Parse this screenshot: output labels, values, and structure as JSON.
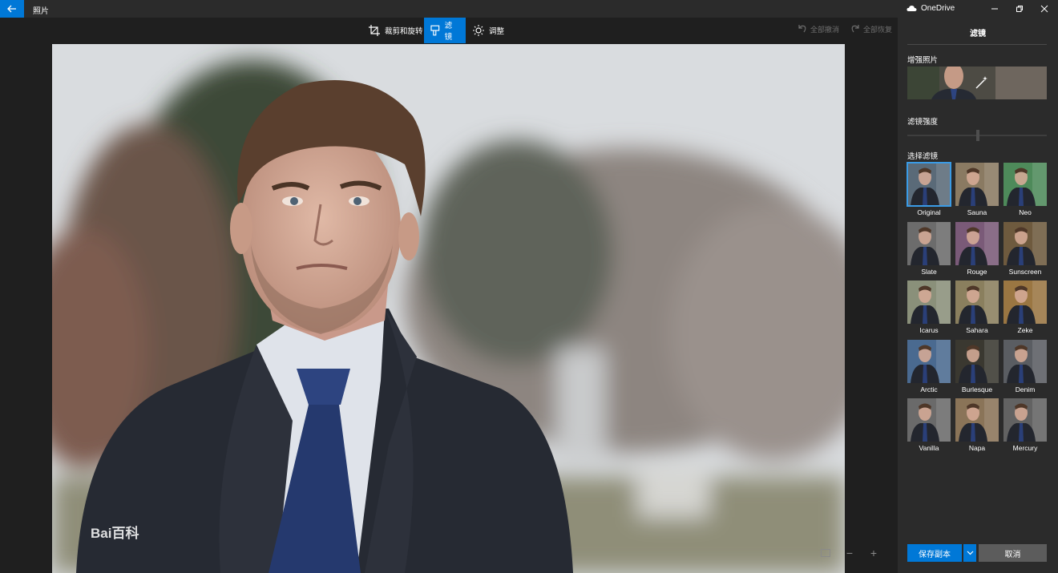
{
  "app": {
    "title": "照片",
    "onedrive_label": "OneDrive"
  },
  "toolbar": {
    "crop_label": "裁剪和旋转",
    "filters_label": "滤镜",
    "adjust_label": "调整",
    "undo_all_label": "全部撤消",
    "redo_all_label": "全部恢复"
  },
  "photo": {
    "watermark": "Bai百科",
    "watermark_paw": "🐾"
  },
  "panel": {
    "title": "滤镜",
    "enhance_label": "增强照片",
    "strength_label": "滤镜强度",
    "strength_value": 0.5,
    "choose_label": "选择滤镜",
    "filters": [
      {
        "name": "Original",
        "tint": "#5a6a78",
        "selected": true
      },
      {
        "name": "Sauna",
        "tint": "#8a7a62"
      },
      {
        "name": "Neo",
        "tint": "#4e8a5a"
      },
      {
        "name": "Slate",
        "tint": "#6c6c6c"
      },
      {
        "name": "Rouge",
        "tint": "#7a5a78"
      },
      {
        "name": "Sunscreen",
        "tint": "#6e5a3e"
      },
      {
        "name": "Icarus",
        "tint": "#8a907a"
      },
      {
        "name": "Sahara",
        "tint": "#8a7f5e"
      },
      {
        "name": "Zeke",
        "tint": "#9a7642"
      },
      {
        "name": "Arctic",
        "tint": "#4a6a90"
      },
      {
        "name": "Burlesque",
        "tint": "#3a3830"
      },
      {
        "name": "Denim",
        "tint": "#5a5d62"
      },
      {
        "name": "Vanilla",
        "tint": "#6a6a6a"
      },
      {
        "name": "Napa",
        "tint": "#8a7458"
      },
      {
        "name": "Mercury",
        "tint": "#626262"
      }
    ],
    "save_label": "保存副本",
    "cancel_label": "取消"
  },
  "colors": {
    "accent": "#0078d7",
    "panel_bg": "#2b2b2b",
    "canvas_bg": "#1f1f1f"
  },
  "icons": {
    "back": "arrow-left-icon",
    "crop": "crop-icon",
    "filter": "brush-icon",
    "adjust": "sun-icon",
    "undo": "undo-icon",
    "redo": "redo-icon",
    "cloud": "cloud-icon",
    "enhance": "magic-wand-icon"
  }
}
